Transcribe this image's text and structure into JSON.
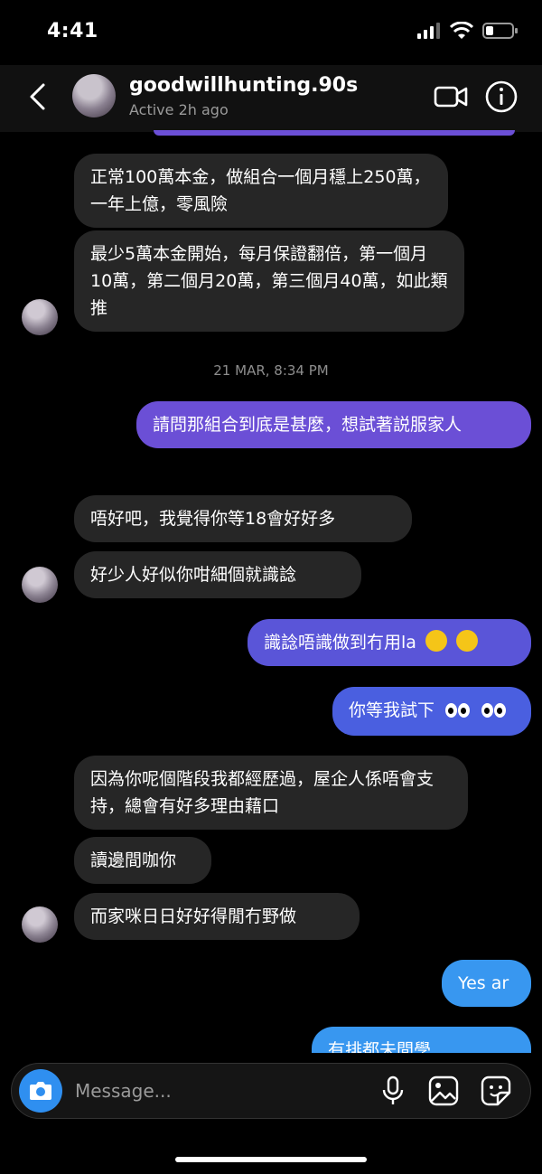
{
  "status_bar": {
    "time": "4:41"
  },
  "header": {
    "username": "goodwillhunting.90s",
    "active_status": "Active 2h ago"
  },
  "messages": [
    {
      "direction": "in",
      "text": "正常100萬本金，做組合一個月穩上250萬，一年上億，零風險"
    },
    {
      "direction": "in",
      "text": "最少5萬本金開始，每月保證翻倍，第一個月10萬，第二個月20萬，第三個月40萬，如此類推"
    },
    {
      "direction": "out",
      "text": "請問那組合到底是甚麼，想試著説服家人"
    },
    {
      "direction": "in",
      "text": "唔好吧，我覺得你等18會好好多"
    },
    {
      "direction": "in",
      "text": "好少人好似你咁細個就識諗"
    },
    {
      "direction": "out",
      "text": "識諗唔識做到冇用la"
    },
    {
      "direction": "out",
      "text": "你等我試下"
    },
    {
      "direction": "in",
      "text": "因為你呢個階段我都經歷過，屋企人係唔會支持，總會有好多理由藉口"
    },
    {
      "direction": "in",
      "text": "讀邊間咖你"
    },
    {
      "direction": "in",
      "text": "而家咪日日好好得閒冇野做"
    },
    {
      "direction": "out",
      "text": "Yes ar"
    },
    {
      "direction": "out",
      "text": "有排都未間學"
    }
  ],
  "timestamp": "21 MAR, 8:34 PM",
  "composer": {
    "placeholder": "Message..."
  },
  "colors": {
    "incoming_bubble": "#262626",
    "outgoing_purple": "#6b4fd6",
    "outgoing_blue": "#3897f0",
    "camera_button": "#2f8ff0"
  },
  "icons": [
    "back-chevron-icon",
    "video-call-icon",
    "info-icon",
    "camera-icon",
    "microphone-icon",
    "gallery-icon",
    "sticker-icon"
  ]
}
